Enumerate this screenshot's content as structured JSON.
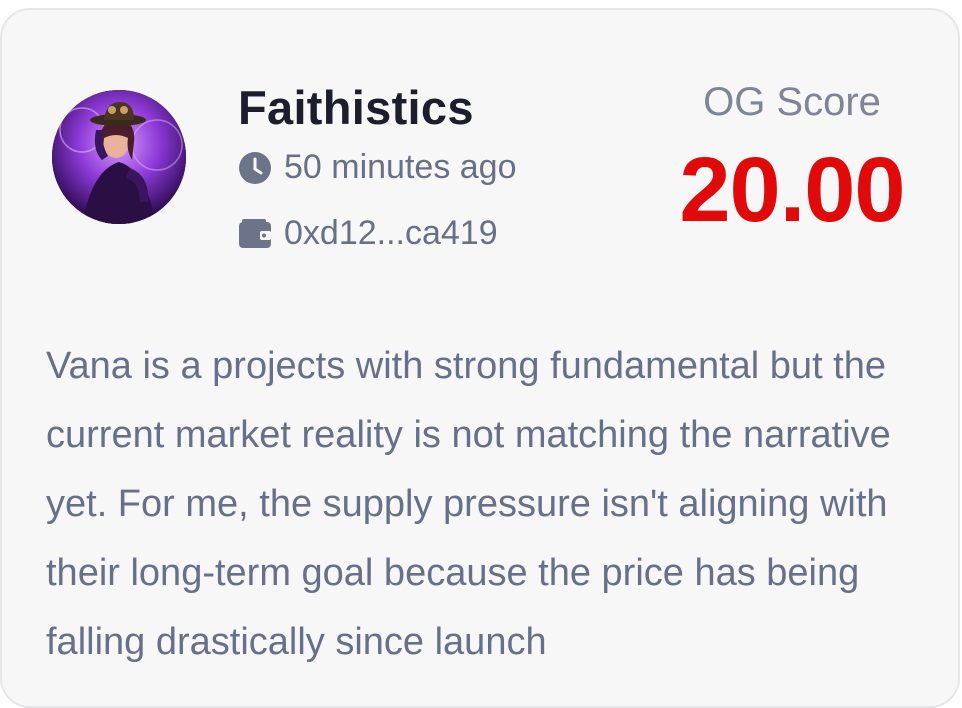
{
  "post": {
    "author_name": "Faithistics",
    "time_ago": "50 minutes ago",
    "wallet_address": "0xd12...ca419",
    "score_label": "OG Score",
    "score_value": "20.00",
    "body_text": "Vana is a projects with strong fundamental but the current market reality is not matching the narrative yet. For me, the supply pressure isn't aligning with their long-term goal because the price has being falling drastically since launch"
  },
  "icons": {
    "clock": "clock-icon",
    "wallet": "wallet-icon"
  },
  "colors": {
    "score": "#e10a0a",
    "name": "#1c1f2b",
    "meta": "#667086",
    "card_bg": "#f7f7f8"
  }
}
